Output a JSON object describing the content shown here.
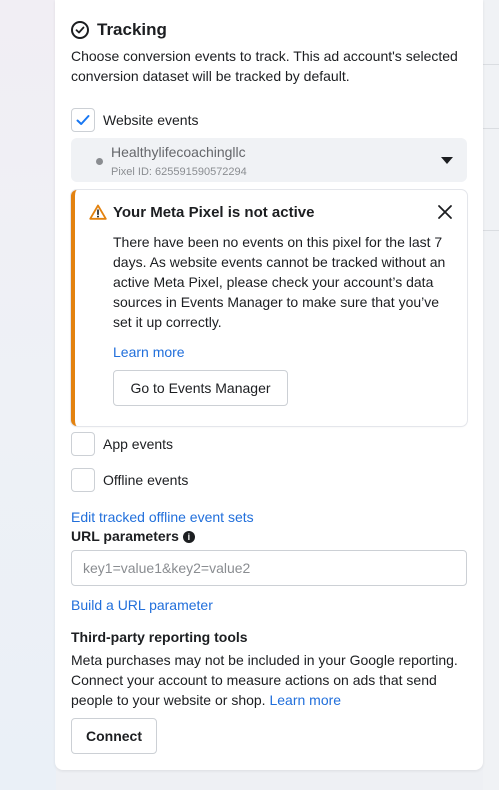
{
  "tracking": {
    "title": "Tracking",
    "description": "Choose conversion events to track. This ad account's selected conversion dataset will be tracked by default."
  },
  "website_events": {
    "label": "Website events",
    "checked": true
  },
  "pixel": {
    "name": "Healthylifecoachingllc",
    "id_text": "Pixel ID: 625591590572294"
  },
  "alert": {
    "title": "Your Meta Pixel is not active",
    "body": "There have been no events on this pixel for the last 7 days. As website events cannot be tracked without an active Meta Pixel, please check your account’s data sources in Events Manager to make sure that you’ve set it up correctly.",
    "learn_more": "Learn more",
    "button": "Go to Events Manager",
    "accent_color": "#e3820f"
  },
  "app_events": {
    "label": "App events",
    "checked": false
  },
  "offline_events": {
    "label": "Offline events",
    "checked": false
  },
  "edit_offline_link": "Edit tracked offline event sets",
  "url_params": {
    "label": "URL parameters",
    "placeholder": "key1=value1&key2=value2",
    "value": "",
    "build_link": "Build a URL parameter"
  },
  "third_party": {
    "title": "Third-party reporting tools",
    "description": "Meta purchases may not be included in your Google reporting. Connect your account to measure actions on ads that send people to your website or shop.",
    "learn_more": "Learn more",
    "connect_button": "Connect"
  },
  "colors": {
    "link": "#216fdb",
    "checkbox_check": "#1877f2",
    "warning": "#e3820f"
  }
}
